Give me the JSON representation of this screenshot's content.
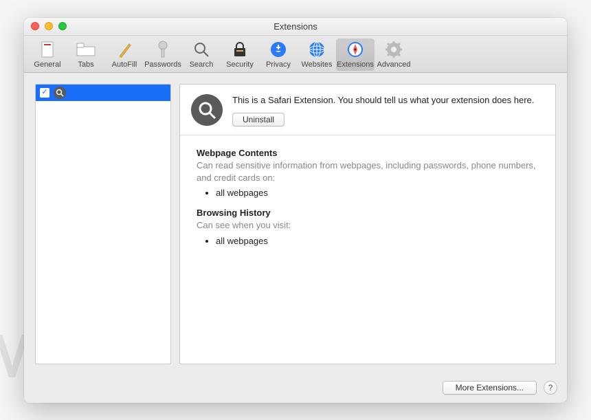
{
  "window": {
    "title": "Extensions"
  },
  "toolbar": [
    {
      "id": "general",
      "label": "General"
    },
    {
      "id": "tabs",
      "label": "Tabs"
    },
    {
      "id": "autofill",
      "label": "AutoFill"
    },
    {
      "id": "passwords",
      "label": "Passwords"
    },
    {
      "id": "search",
      "label": "Search"
    },
    {
      "id": "security",
      "label": "Security"
    },
    {
      "id": "privacy",
      "label": "Privacy"
    },
    {
      "id": "websites",
      "label": "Websites"
    },
    {
      "id": "extensions",
      "label": "Extensions",
      "selected": true
    },
    {
      "id": "advanced",
      "label": "Advanced"
    }
  ],
  "sidebar": {
    "items": [
      {
        "checked": true,
        "icon": "magnifier"
      }
    ]
  },
  "detail": {
    "description": "This is a Safari Extension. You should tell us what your extension does here.",
    "uninstall_label": "Uninstall",
    "permissions": [
      {
        "title": "Webpage Contents",
        "desc": "Can read sensitive information from webpages, including passwords, phone numbers, and credit cards on:",
        "items": [
          "all webpages"
        ]
      },
      {
        "title": "Browsing History",
        "desc": "Can see when you visit:",
        "items": [
          "all webpages"
        ]
      }
    ]
  },
  "footer": {
    "more_label": "More Extensions...",
    "help_label": "?"
  }
}
